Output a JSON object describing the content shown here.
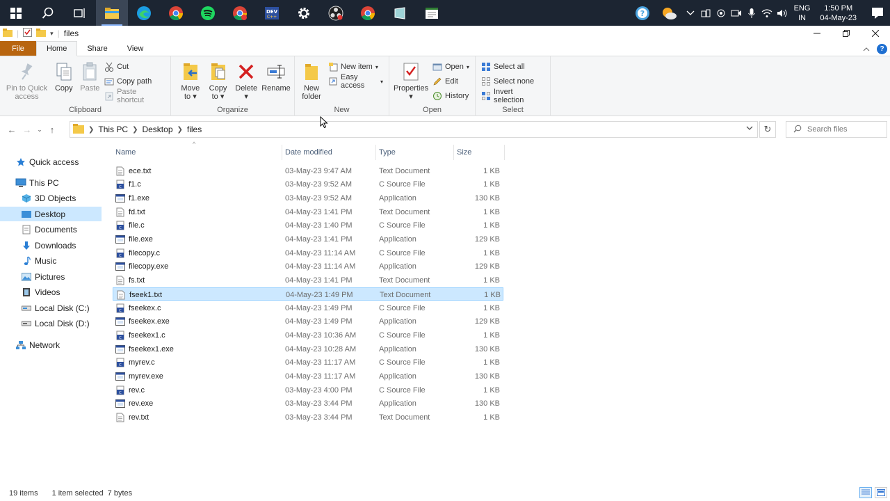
{
  "colors": {
    "file_tab": "#b8650f",
    "selection": "#cce8ff",
    "taskbar": "#1c2532",
    "delete_red": "#d42020",
    "folder_yellow": "#f4c949"
  },
  "taskbar": {
    "icons": [
      "windows-start-icon",
      "search-icon",
      "task-view-icon",
      "file-explorer-icon",
      "edge-icon",
      "chrome-icon",
      "spotify-icon",
      "chrome-icon",
      "dev-cpp-icon",
      "settings-icon",
      "obs-icon",
      "chrome-icon",
      "notepad-icon",
      "app-icon"
    ],
    "tray": {
      "language_top": "ENG",
      "language_bottom": "IN",
      "time": "1:50 PM",
      "date": "04-May-23",
      "notification_count": "6"
    }
  },
  "window": {
    "title": "files",
    "tabs": [
      "File",
      "Home",
      "Share",
      "View"
    ],
    "active_tab": "Home"
  },
  "ribbon": {
    "clipboard": {
      "label": "Clipboard",
      "pin": "Pin to Quick access",
      "pin_l1": "Pin to Quick",
      "pin_l2": "access",
      "copy": "Copy",
      "paste": "Paste",
      "cut": "Cut",
      "copy_path": "Copy path",
      "paste_shortcut": "Paste shortcut"
    },
    "organize": {
      "label": "Organize",
      "move_l1": "Move",
      "move_l2": "to",
      "copy_l1": "Copy",
      "copy_l2": "to",
      "delete": "Delete",
      "rename": "Rename"
    },
    "new": {
      "label": "New",
      "folder_l1": "New",
      "folder_l2": "folder",
      "new_item": "New item",
      "easy_access": "Easy access"
    },
    "open": {
      "label": "Open",
      "properties": "Properties",
      "open": "Open",
      "edit": "Edit",
      "history": "History"
    },
    "select": {
      "label": "Select",
      "select_all": "Select all",
      "select_none": "Select none",
      "invert": "Invert selection"
    }
  },
  "address": {
    "crumbs": [
      "This PC",
      "Desktop",
      "files"
    ],
    "search_placeholder": "Search files"
  },
  "nav": {
    "quick_access": "Quick access",
    "this_pc": "This PC",
    "children": [
      "3D Objects",
      "Desktop",
      "Documents",
      "Downloads",
      "Music",
      "Pictures",
      "Videos",
      "Local Disk (C:)",
      "Local Disk (D:)"
    ],
    "network": "Network",
    "selected": "Desktop"
  },
  "columns": {
    "name": "Name",
    "date": "Date modified",
    "type": "Type",
    "size": "Size"
  },
  "files": [
    {
      "name": "ece.txt",
      "date": "03-May-23 9:47 AM",
      "type": "Text Document",
      "size": "1 KB",
      "kind": "txt"
    },
    {
      "name": "f1.c",
      "date": "03-May-23 9:52 AM",
      "type": "C Source File",
      "size": "1 KB",
      "kind": "c"
    },
    {
      "name": "f1.exe",
      "date": "03-May-23 9:52 AM",
      "type": "Application",
      "size": "130 KB",
      "kind": "exe"
    },
    {
      "name": "fd.txt",
      "date": "04-May-23 1:41 PM",
      "type": "Text Document",
      "size": "1 KB",
      "kind": "txt"
    },
    {
      "name": "file.c",
      "date": "04-May-23 1:40 PM",
      "type": "C Source File",
      "size": "1 KB",
      "kind": "c"
    },
    {
      "name": "file.exe",
      "date": "04-May-23 1:41 PM",
      "type": "Application",
      "size": "129 KB",
      "kind": "exe"
    },
    {
      "name": "filecopy.c",
      "date": "04-May-23 11:14 AM",
      "type": "C Source File",
      "size": "1 KB",
      "kind": "c"
    },
    {
      "name": "filecopy.exe",
      "date": "04-May-23 11:14 AM",
      "type": "Application",
      "size": "129 KB",
      "kind": "exe"
    },
    {
      "name": "fs.txt",
      "date": "04-May-23 1:41 PM",
      "type": "Text Document",
      "size": "1 KB",
      "kind": "txt"
    },
    {
      "name": "fseek1.txt",
      "date": "04-May-23 1:49 PM",
      "type": "Text Document",
      "size": "1 KB",
      "kind": "txt",
      "selected": true
    },
    {
      "name": "fseekex.c",
      "date": "04-May-23 1:49 PM",
      "type": "C Source File",
      "size": "1 KB",
      "kind": "c"
    },
    {
      "name": "fseekex.exe",
      "date": "04-May-23 1:49 PM",
      "type": "Application",
      "size": "129 KB",
      "kind": "exe"
    },
    {
      "name": "fseekex1.c",
      "date": "04-May-23 10:36 AM",
      "type": "C Source File",
      "size": "1 KB",
      "kind": "c"
    },
    {
      "name": "fseekex1.exe",
      "date": "04-May-23 10:28 AM",
      "type": "Application",
      "size": "130 KB",
      "kind": "exe"
    },
    {
      "name": "myrev.c",
      "date": "04-May-23 11:17 AM",
      "type": "C Source File",
      "size": "1 KB",
      "kind": "c"
    },
    {
      "name": "myrev.exe",
      "date": "04-May-23 11:17 AM",
      "type": "Application",
      "size": "130 KB",
      "kind": "exe"
    },
    {
      "name": "rev.c",
      "date": "03-May-23 4:00 PM",
      "type": "C Source File",
      "size": "1 KB",
      "kind": "c"
    },
    {
      "name": "rev.exe",
      "date": "03-May-23 3:44 PM",
      "type": "Application",
      "size": "130 KB",
      "kind": "exe"
    },
    {
      "name": "rev.txt",
      "date": "03-May-23 3:44 PM",
      "type": "Text Document",
      "size": "1 KB",
      "kind": "txt"
    }
  ],
  "status": {
    "count": "19 items",
    "selection": "1 item selected  7 bytes"
  }
}
